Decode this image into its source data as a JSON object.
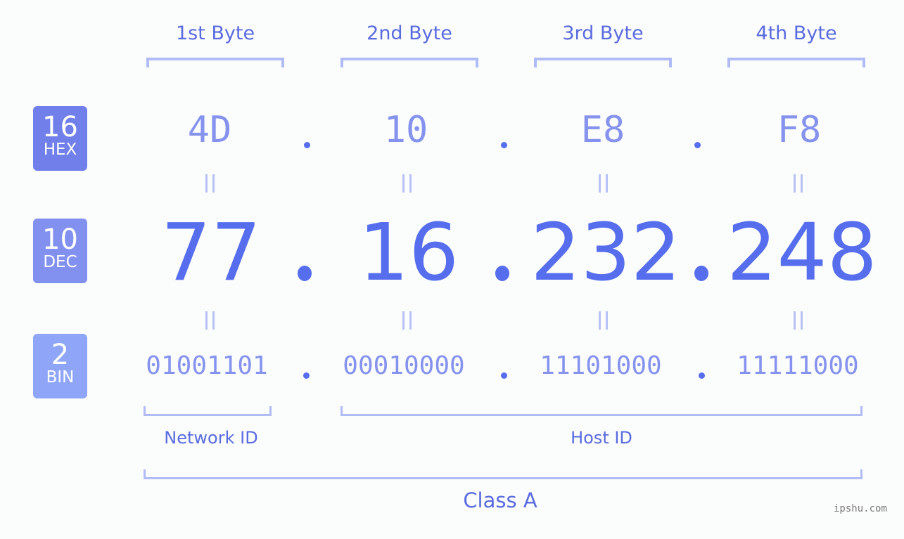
{
  "byte_headers": [
    "1st Byte",
    "2nd Byte",
    "3rd Byte",
    "4th Byte"
  ],
  "badges": {
    "hex": {
      "number": "16",
      "label": "HEX",
      "color": "#717fea"
    },
    "dec": {
      "number": "10",
      "label": "DEC",
      "color": "#8291f0"
    },
    "bin": {
      "number": "2",
      "label": "BIN",
      "color": "#8fa5f7"
    }
  },
  "hex_octets": [
    "4D",
    "10",
    "E8",
    "F8"
  ],
  "dec_octets": [
    "77",
    "16",
    "232",
    "248"
  ],
  "bin_octets": [
    "01001101",
    "00010000",
    "11101000",
    "11111000"
  ],
  "separator": ".",
  "network_label": "Network ID",
  "host_label": "Host ID",
  "class_label": "Class A",
  "watermark": "ipshu.com",
  "colors": {
    "accent": "#566ded",
    "hex_text": "#8592ee",
    "bracket": "#b1bbf6",
    "equals": "#b8c2f6",
    "background": "#fbfcfc"
  }
}
